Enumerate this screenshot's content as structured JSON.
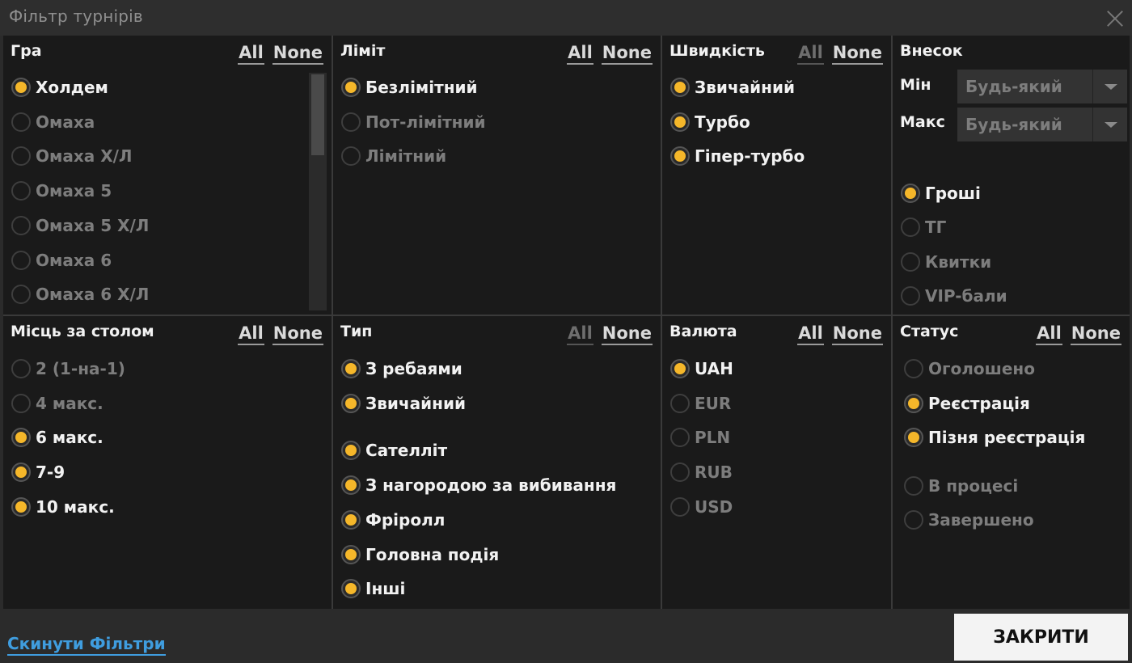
{
  "window": {
    "title": "Фільтр турнірів"
  },
  "game": {
    "title": "Гра",
    "all": "All",
    "none": "None",
    "options": [
      {
        "label": "Холдем",
        "on": true
      },
      {
        "label": "Омаха",
        "on": false
      },
      {
        "label": "Омаха Х/Л",
        "on": false
      },
      {
        "label": "Омаха 5",
        "on": false
      },
      {
        "label": "Омаха 5 Х/Л",
        "on": false
      },
      {
        "label": "Омаха 6",
        "on": false
      },
      {
        "label": "Омаха 6 Х/Л",
        "on": false
      }
    ]
  },
  "limit": {
    "title": "Ліміт",
    "all": "All",
    "none": "None",
    "options": [
      {
        "label": "Безлімітний",
        "on": true
      },
      {
        "label": "Пот-лімітний",
        "on": false
      },
      {
        "label": "Лімітний",
        "on": false
      }
    ]
  },
  "speed": {
    "title": "Швидкість",
    "all": "All",
    "none": "None",
    "options": [
      {
        "label": "Звичайний",
        "on": true
      },
      {
        "label": "Турбо",
        "on": true
      },
      {
        "label": "Гіпер-турбо",
        "on": true
      }
    ]
  },
  "buyin": {
    "title": "Внесок",
    "min_label": "Мін",
    "min_value": "Будь-який",
    "max_label": "Макс",
    "max_value": "Будь-який",
    "options": [
      {
        "label": "Гроші",
        "on": true
      },
      {
        "label": "ТГ",
        "on": false
      },
      {
        "label": "Квитки",
        "on": false
      },
      {
        "label": "VIP-бали",
        "on": false
      }
    ]
  },
  "seats": {
    "title": "Місць за столом",
    "all": "All",
    "none": "None",
    "options": [
      {
        "label": "2 (1-на-1)",
        "on": false
      },
      {
        "label": "4 макс.",
        "on": false
      },
      {
        "label": "6 макс.",
        "on": true
      },
      {
        "label": "7-9",
        "on": true
      },
      {
        "label": "10 макс.",
        "on": true
      }
    ]
  },
  "type": {
    "title": "Тип",
    "all": "All",
    "none": "None",
    "options": [
      {
        "label": "З ребаями",
        "on": true
      },
      {
        "label": "Звичайний",
        "on": true
      },
      {
        "label": "Сателліт",
        "on": true
      },
      {
        "label": "З нагородою за вибивання",
        "on": true
      },
      {
        "label": "Фріролл",
        "on": true
      },
      {
        "label": "Головна подія",
        "on": true
      },
      {
        "label": "Інші",
        "on": true
      }
    ]
  },
  "currency": {
    "title": "Валюта",
    "all": "All",
    "none": "None",
    "options": [
      {
        "label": "UAH",
        "on": true
      },
      {
        "label": "EUR",
        "on": false
      },
      {
        "label": "PLN",
        "on": false
      },
      {
        "label": "RUB",
        "on": false
      },
      {
        "label": "USD",
        "on": false
      }
    ]
  },
  "status": {
    "title": "Статус",
    "all": "All",
    "none": "None",
    "options": [
      {
        "label": "Оголошено",
        "on": false
      },
      {
        "label": "Реєстрація",
        "on": true
      },
      {
        "label": "Пізня реєстрація",
        "on": true
      },
      {
        "label": "В процесі",
        "on": false
      },
      {
        "label": "Завершено",
        "on": false
      }
    ]
  },
  "footer": {
    "reset_label": "Скинути Фільтри",
    "close_label": "ЗАКРИТИ"
  },
  "colors": {
    "accent": "#f5b72a",
    "link": "#3f9ddf",
    "panel": "#1a1a1a"
  },
  "icons": {
    "close": "close-icon",
    "dropdown": "chevron-down-icon",
    "radio": "radio-icon"
  }
}
